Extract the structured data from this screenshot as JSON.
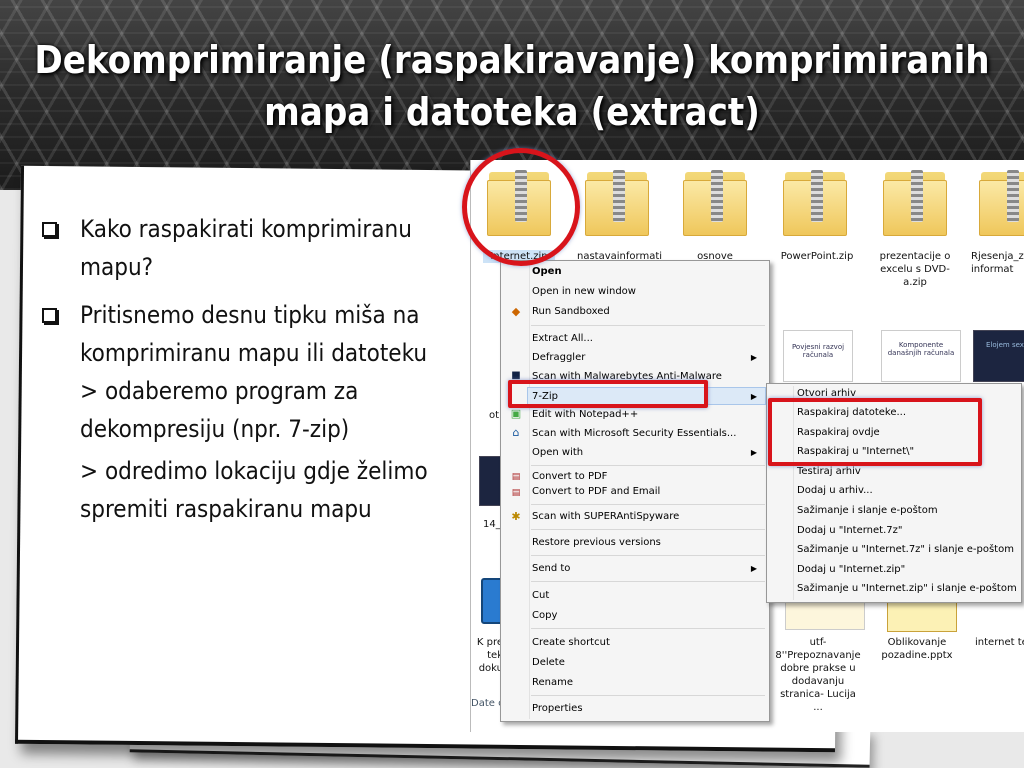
{
  "slide": {
    "title_line1": "Dekomprimiranje (raspakiravanje) komprimiranih",
    "title_line2": "mapa i datoteka (extract)",
    "bullet1_line1": "Kako raspakirati komprimiranu",
    "bullet1_line2": "mapu?",
    "bullet2_line1": "Pritisnemo desnu tipku miša na",
    "bullet2_line2": "komprimiranu mapu ili datoteku",
    "bullet2_line3": "> odaberemo program za",
    "bullet2_line4": "dekompresiju (npr. 7-zip)",
    "sub_line1": "> odredimo lokaciju gdje želimo",
    "sub_line2": "spremiti raspakiranu mapu"
  },
  "explorer": {
    "files_row1": [
      "Internet.zip",
      "nastavainformati",
      "osnove",
      "PowerPoint.zip",
      "prezentacije o excelu s DVD-a.zip",
      "Rjesenja_z informat"
    ],
    "left_fragments": [
      "ot",
      "14_i",
      "K pre tek doku"
    ],
    "thumb_texts": {
      "thumb1": "Povjesni razvoj računala",
      "thumb2": "Komponente današnjih računala",
      "thumb3": "Elojem sex"
    },
    "files_row3": [
      "utf-8''Prepoznavanje dobre prakse u dodavanju stranica- Lucija ...",
      "Oblikovanje pozadine.pptx",
      "internet te"
    ],
    "status_text": "Date cr"
  },
  "context_menu": {
    "items": [
      "Open",
      "Open in new window",
      "Run Sandboxed",
      "Extract All...",
      "Defraggler",
      "Scan with Malwarebytes Anti-Malware",
      "7-Zip",
      "Edit with Notepad++",
      "Scan with Microsoft Security Essentials...",
      "Open with",
      "Convert to PDF",
      "Convert to PDF and Email",
      "Scan with SUPERAntiSpyware",
      "Restore previous versions",
      "Send to",
      "Cut",
      "Copy",
      "Create shortcut",
      "Delete",
      "Rename",
      "Properties"
    ]
  },
  "submenu_7zip": {
    "items": [
      "Otvori arhiv",
      "Raspakiraj datoteke...",
      "Raspakiraj ovdje",
      "Raspakiraj u \"Internet\\\"",
      "Testiraj arhiv",
      "Dodaj u arhiv...",
      "Sažimanje i slanje e-poštom",
      "Dodaj u \"Internet.7z\"",
      "Sažimanje u \"Internet.7z\" i slanje e-poštom",
      "Dodaj u \"Internet.zip\"",
      "Sažimanje u \"Internet.zip\" i slanje e-poštom"
    ]
  },
  "colors": {
    "highlight_red": "#d8141b",
    "menu_bg": "#f5f5f5",
    "menu_hover": "#dce9f7"
  }
}
